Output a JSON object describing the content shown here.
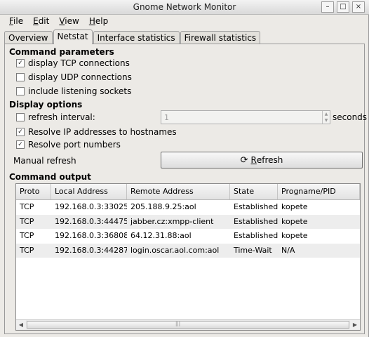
{
  "window": {
    "title": "Gnome Network Monitor"
  },
  "menu": {
    "file": {
      "mnemonic": "F",
      "rest": "ile"
    },
    "edit": {
      "mnemonic": "E",
      "rest": "dit"
    },
    "view": {
      "mnemonic": "V",
      "rest": "iew"
    },
    "help": {
      "mnemonic": "H",
      "rest": "elp"
    }
  },
  "tabs": [
    "Overview",
    "Netstat",
    "Interface statistics",
    "Firewall statistics"
  ],
  "command_parameters": {
    "heading": "Command parameters",
    "tcp": {
      "label": "display TCP connections",
      "checked": true
    },
    "udp": {
      "label": "display UDP connections",
      "checked": false
    },
    "listening": {
      "label": "include listening sockets",
      "checked": false
    }
  },
  "display_options": {
    "heading": "Display options",
    "refresh_interval": {
      "label": "refresh interval:",
      "checked": false,
      "value": "1",
      "unit": "seconds"
    },
    "resolve_ip": {
      "label": "Resolve IP addresses to hostnames",
      "checked": true
    },
    "resolve_port": {
      "label": "Resolve port numbers",
      "checked": true
    }
  },
  "manual_refresh": {
    "label": "Manual refresh",
    "button_mnemonic": "R",
    "button_rest": "efresh"
  },
  "command_output": {
    "heading": "Command output",
    "columns": [
      "Proto",
      "Local Address",
      "Remote Address",
      "State",
      "Progname/PID"
    ],
    "rows": [
      [
        "TCP",
        "192.168.0.3:33025",
        "205.188.9.25:aol",
        "Established",
        "kopete"
      ],
      [
        "TCP",
        "192.168.0.3:44475",
        "jabber.cz:xmpp-client",
        "Established",
        "kopete"
      ],
      [
        "TCP",
        "192.168.0.3:36808",
        "64.12.31.88:aol",
        "Established",
        "kopete"
      ],
      [
        "TCP",
        "192.168.0.3:44287",
        "login.oscar.aol.com:aol",
        "Time-Wait",
        "N/A"
      ]
    ]
  },
  "icons": {
    "minimize": "minimize-icon",
    "maximize": "maximize-icon",
    "close": "close-icon",
    "refresh": "refresh-icon",
    "check": "check-icon"
  }
}
